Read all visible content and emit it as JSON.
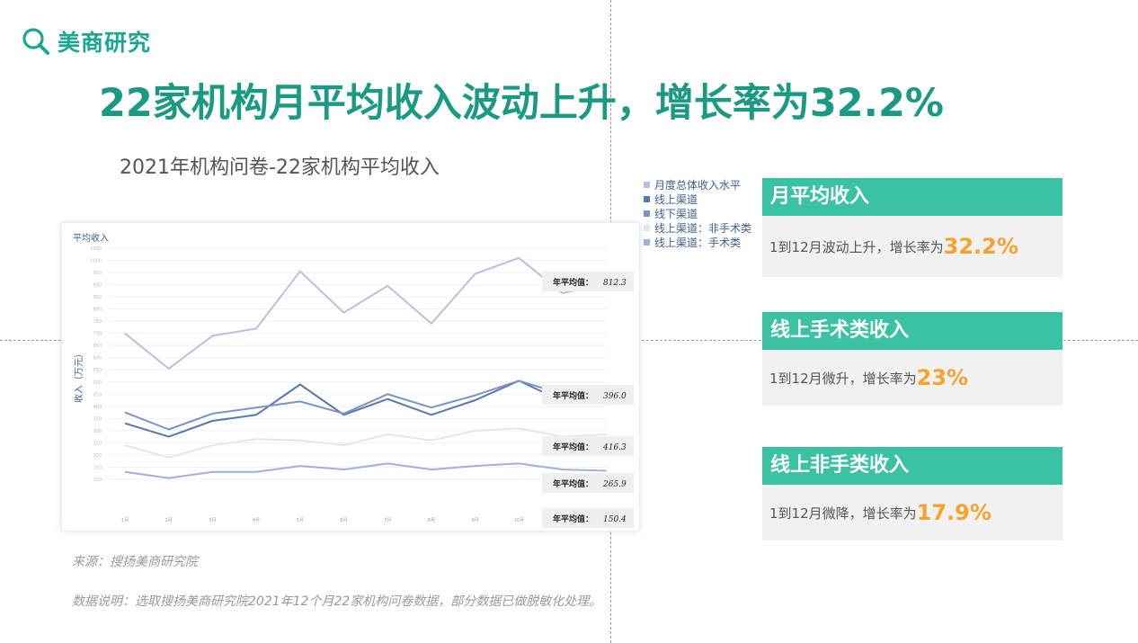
{
  "brand": {
    "name": "美商研究"
  },
  "header": {
    "title": "22家机构月平均收入波动上升，增长率为32.2%"
  },
  "chart_section": {
    "title": "2021年机构问卷-22家机构平均收入"
  },
  "colors": {
    "accent_green": "#1a9a83",
    "card_green": "#3bc2a4",
    "highlight_orange": "#f5a22f"
  },
  "chart_data": {
    "type": "line",
    "title": "平均收入",
    "ylabel": "收入（万元）",
    "xlabel": "",
    "categories": [
      "1月",
      "2月",
      "3月",
      "4月",
      "5月",
      "6月",
      "7月",
      "8月",
      "9月",
      "10月",
      "11月",
      "12月"
    ],
    "ylim": [
      0,
      1050
    ],
    "yticks": [
      100,
      150,
      200,
      250,
      300,
      350,
      400,
      450,
      500,
      550,
      600,
      650,
      700,
      750,
      800,
      850,
      900,
      950,
      1000,
      1050
    ],
    "grid": true,
    "legend_position": "right",
    "series": [
      {
        "name": "月度总体收入水平",
        "color": "#b7c1df",
        "values": [
          700,
          555,
          690,
          720,
          955,
          785,
          895,
          740,
          945,
          1010,
          865,
          905
        ]
      },
      {
        "name": "线上渠道",
        "color": "#5877ac",
        "values": [
          330,
          275,
          340,
          365,
          490,
          365,
          430,
          365,
          425,
          505,
          420,
          420
        ]
      },
      {
        "name": "线下渠道",
        "color": "#7a94c3",
        "values": [
          375,
          305,
          370,
          395,
          420,
          370,
          450,
          395,
          445,
          505,
          450,
          435
        ]
      },
      {
        "name": "线上渠道：非手术类",
        "color": "#e3e6ee",
        "values": [
          240,
          190,
          240,
          265,
          260,
          240,
          285,
          260,
          300,
          310,
          275,
          285
        ]
      },
      {
        "name": "线上渠道：手术类",
        "color": "#9fb1d4",
        "values": [
          130,
          105,
          130,
          130,
          155,
          140,
          165,
          140,
          155,
          165,
          140,
          135
        ]
      }
    ],
    "annotations": [
      {
        "label": "年平均值：",
        "value": "812.3"
      },
      {
        "label": "年平均值：",
        "value": "396.0"
      },
      {
        "label": "年平均值：",
        "value": "416.3"
      },
      {
        "label": "年平均值：",
        "value": "265.9"
      },
      {
        "label": "年平均值：",
        "value": "150.4"
      }
    ]
  },
  "cards": [
    {
      "title": "月平均收入",
      "text": "1到12月波动上升，增长率为",
      "highlight": "32.2%"
    },
    {
      "title": "线上手术类收入",
      "text": "1到12月微升，增长率为",
      "highlight": "23%"
    },
    {
      "title": "线上非手类收入",
      "text": "1到12月微降，增长率为",
      "highlight": "17.9%"
    }
  ],
  "footer": {
    "source": "来源：搜扬美商研究院",
    "note": "数据说明：选取搜扬美商研究院2021年12个月22家机构问卷数据，部分数据已做脱敏化处理。"
  }
}
